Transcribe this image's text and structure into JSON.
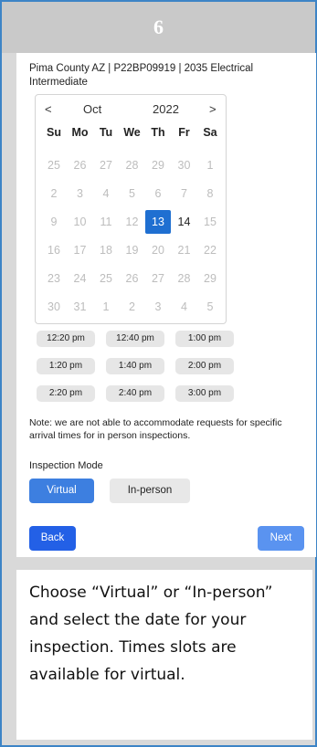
{
  "step": {
    "number": "6"
  },
  "form": {
    "title": "Pima County AZ | P22BP09919 | 2035 Electrical Intermediate",
    "calendar": {
      "prev_glyph": "<",
      "next_glyph": ">",
      "month": "Oct",
      "year": "2022",
      "weekdays": [
        "Su",
        "Mo",
        "Tu",
        "We",
        "Th",
        "Fr",
        "Sa"
      ],
      "weeks": [
        [
          "25",
          "26",
          "27",
          "28",
          "29",
          "30",
          "1"
        ],
        [
          "2",
          "3",
          "4",
          "5",
          "6",
          "7",
          "8"
        ],
        [
          "9",
          "10",
          "11",
          "12",
          "13",
          "14",
          "15"
        ],
        [
          "16",
          "17",
          "18",
          "19",
          "20",
          "21",
          "22"
        ],
        [
          "23",
          "24",
          "25",
          "26",
          "27",
          "28",
          "29"
        ],
        [
          "30",
          "31",
          "1",
          "2",
          "3",
          "4",
          "5"
        ]
      ],
      "selected_day": "13",
      "available_day": "14"
    },
    "time_slots": [
      [
        "12:20 pm",
        "12:40 pm",
        "1:00 pm"
      ],
      [
        "1:20 pm",
        "1:40 pm",
        "2:00 pm"
      ],
      [
        "2:20 pm",
        "2:40 pm",
        "3:00 pm"
      ]
    ],
    "note": "Note: we are not able to accommodate requests for specific arrival times for in person inspections.",
    "mode_label": "Inspection Mode",
    "mode_virtual": "Virtual",
    "mode_inperson": "In-person",
    "back_label": "Back",
    "next_label": "Next"
  },
  "description": {
    "text": "Choose “Virtual” or “In-person” and select the date for your inspection. Times slots are available for virtual."
  },
  "colors": {
    "selected": "#1f6fd1",
    "virtual_button": "#3d7fe0",
    "back_button": "#2360e6",
    "next_button": "#5a93f0",
    "frame_border": "#3d84c6"
  }
}
